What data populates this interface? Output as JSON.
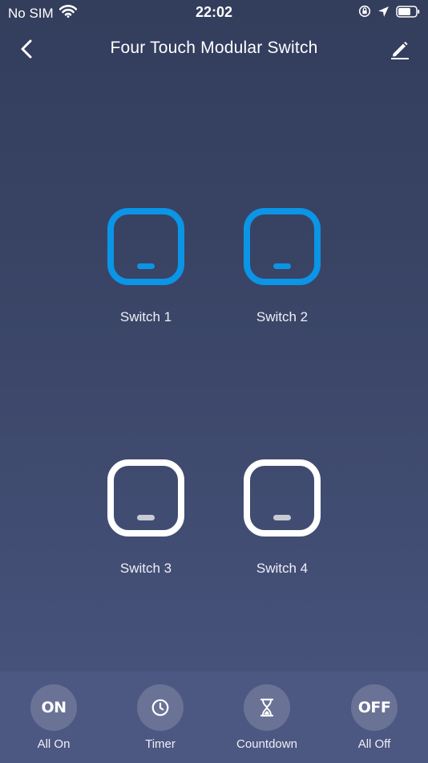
{
  "status_bar": {
    "carrier": "No SIM",
    "time": "22:02",
    "icons": [
      "wifi-icon",
      "orientation-lock-icon",
      "location-arrow-icon",
      "battery-icon"
    ]
  },
  "nav": {
    "title": "Four Touch Modular Switch",
    "back_icon": "chevron-left-icon",
    "edit_icon": "pencil-icon"
  },
  "switches": [
    {
      "label": "Switch 1",
      "state": "on"
    },
    {
      "label": "Switch 2",
      "state": "on"
    },
    {
      "label": "Switch 3",
      "state": "off"
    },
    {
      "label": "Switch 4",
      "state": "off"
    }
  ],
  "actions": [
    {
      "label": "All On",
      "icon_text": "ON"
    },
    {
      "label": "Timer",
      "icon": "clock-icon"
    },
    {
      "label": "Countdown",
      "icon": "hourglass-icon"
    },
    {
      "label": "All Off",
      "icon_text": "OFF"
    }
  ],
  "colors": {
    "on_accent": "#0a95e6",
    "off_outline": "#ffffff",
    "bottom_bar": "#4d5882",
    "action_circle": "#6a7296"
  }
}
